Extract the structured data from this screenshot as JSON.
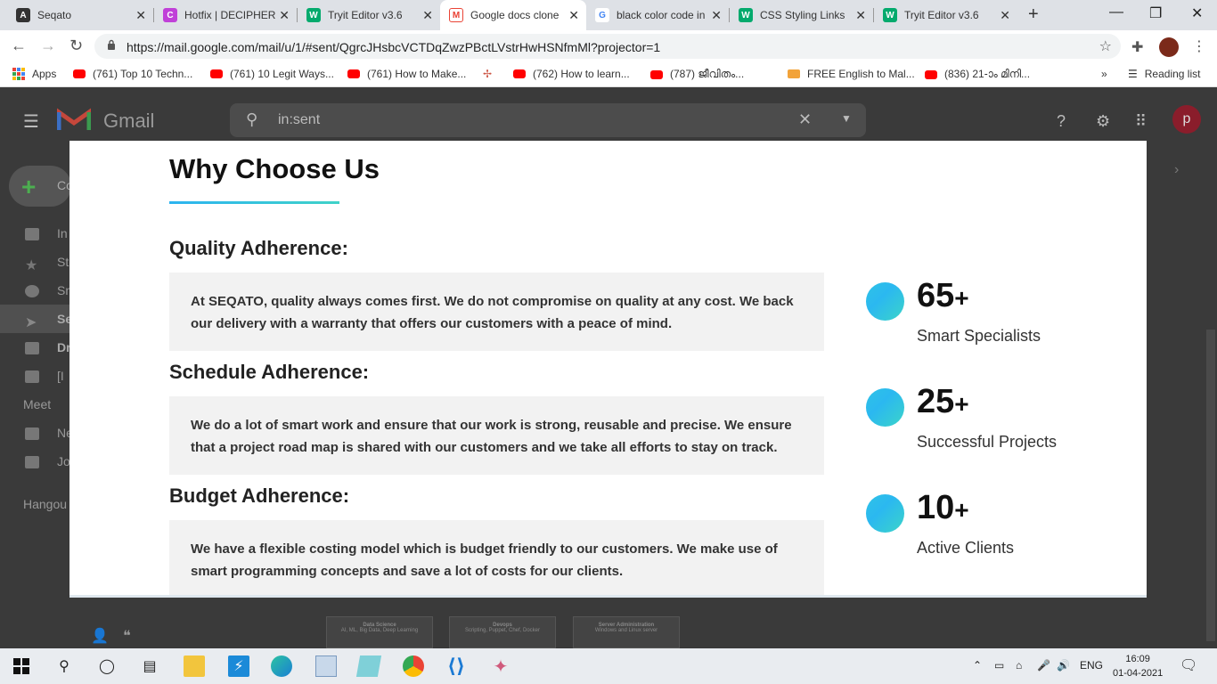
{
  "browser": {
    "tabs": [
      {
        "title": "Seqato",
        "icon": "seqato-icon",
        "color": "#333333"
      },
      {
        "title": "Hotfix | DECIPHER",
        "icon": "decipher-icon",
        "color": "#c040d8"
      },
      {
        "title": "Tryit Editor v3.6",
        "icon": "w3schools-icon",
        "color": "#04aa6d"
      },
      {
        "title": "Google docs clone",
        "icon": "gmail-icon",
        "color": "#ea4335"
      },
      {
        "title": "black color code in",
        "icon": "google-icon",
        "color": "#4285f4"
      },
      {
        "title": "CSS Styling Links",
        "icon": "w3schools-icon",
        "color": "#04aa6d"
      },
      {
        "title": "Tryit Editor v3.6",
        "icon": "w3schools-icon",
        "color": "#04aa6d"
      }
    ],
    "new_tab": "+",
    "url": "https://mail.google.com/mail/u/1/#sent/QgrcJHsbcVCTDqZwzPBctLVstrHwHSNfmMl?projector=1",
    "bookmarks": [
      {
        "label": "Apps",
        "icon": "apps-icon"
      },
      {
        "label": "(761) Top 10 Techn...",
        "icon": "youtube-icon"
      },
      {
        "label": "(761) 10 Legit Ways...",
        "icon": "youtube-icon"
      },
      {
        "label": "(761) How to Make...",
        "icon": "youtube-icon"
      },
      {
        "label": "",
        "icon": "pinwheel-icon"
      },
      {
        "label": "(762) How to learn...",
        "icon": "youtube-icon"
      },
      {
        "label": "(787) ജീവിതം...",
        "icon": "youtube-icon"
      },
      {
        "label": "FREE English to Mal...",
        "icon": "fw-icon"
      },
      {
        "label": "(836) 21-ാം മിനി...",
        "icon": "youtube-icon"
      }
    ],
    "more_bookmarks": "»",
    "reading_list": "Reading list"
  },
  "gmail": {
    "logo_text": "Gmail",
    "search_query": "in:sent",
    "compose_label": "Co",
    "sidebar": [
      {
        "label": "In"
      },
      {
        "label": "St"
      },
      {
        "label": "Sn"
      },
      {
        "label": "Se"
      },
      {
        "label": "Dr"
      },
      {
        "label": "[I"
      }
    ],
    "meet_label": "Meet",
    "meet_items": [
      {
        "label": "Ne"
      },
      {
        "label": "Jo"
      }
    ],
    "hangouts_label": "Hangou",
    "avatar_letter": "p",
    "attachments": [
      {
        "title": "Data Science",
        "sub": "AI, ML, Big Data, Deep Learning"
      },
      {
        "title": "Devops",
        "sub": "Scripting, Puppet, Chef, Docker"
      },
      {
        "title": "Server Administration",
        "sub": "Windows and Linux server"
      }
    ]
  },
  "content": {
    "heading": "Why Choose Us",
    "sections": [
      {
        "title": "Quality Adherence:",
        "text": "At SEQATO, quality always comes first. We do not compromise on quality at any cost. We back our delivery with a warranty that offers our customers with a peace of mind."
      },
      {
        "title": "Schedule Adherence:",
        "text": "We do a lot of smart work and ensure that our work is strong, reusable and precise. We ensure that a project road map is shared with our customers  and we take all efforts to stay on track."
      },
      {
        "title": "Budget Adherence:",
        "text": "We have a flexible costing model which is budget friendly to our customers. We make use of smart programming concepts and save a lot of costs for our clients."
      }
    ],
    "stats": [
      {
        "number": "65",
        "plus": "+",
        "label": "Smart Specialists"
      },
      {
        "number": "25",
        "plus": "+",
        "label": "Successful Projects"
      },
      {
        "number": "10",
        "plus": "+",
        "label": "Active Clients"
      }
    ],
    "accent_gradient": [
      "#2cb4f0",
      "#3fd2c8"
    ]
  },
  "taskbar": {
    "language": "ENG",
    "time": "16:09",
    "date": "01-04-2021"
  }
}
